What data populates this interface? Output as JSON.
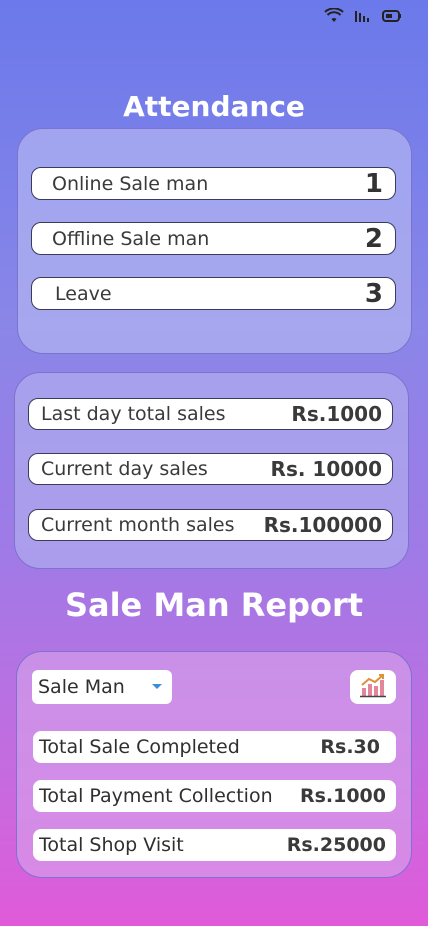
{
  "status_bar": {
    "wifi_icon": "wifi-icon",
    "signal_icon": "signal-icon",
    "battery_icon": "battery-icon"
  },
  "attendance": {
    "title": "Attendance",
    "rows": [
      {
        "label": "Online Sale man",
        "value": "1"
      },
      {
        "label": "Offline Sale man",
        "value": "2"
      },
      {
        "label": "Leave",
        "value": "3"
      }
    ]
  },
  "sales": {
    "rows": [
      {
        "label": "Last day total sales",
        "value": "Rs.1000"
      },
      {
        "label": "Current day sales",
        "value": "Rs. 10000"
      },
      {
        "label": "Current month sales",
        "value": "Rs.100000"
      }
    ]
  },
  "report": {
    "title": "Sale Man Report",
    "select_value": "Sale Man",
    "chart_icon": "bar-chart-trend-icon",
    "rows": [
      {
        "label": "Total Sale Completed",
        "value": "Rs.30"
      },
      {
        "label": "Total Payment Collection",
        "value": "Rs.1000"
      },
      {
        "label": "Total Shop Visit",
        "value": "Rs.25000"
      }
    ]
  },
  "colors": {
    "accent_blue": "#3b8fd9",
    "text_white": "#ffffff"
  }
}
